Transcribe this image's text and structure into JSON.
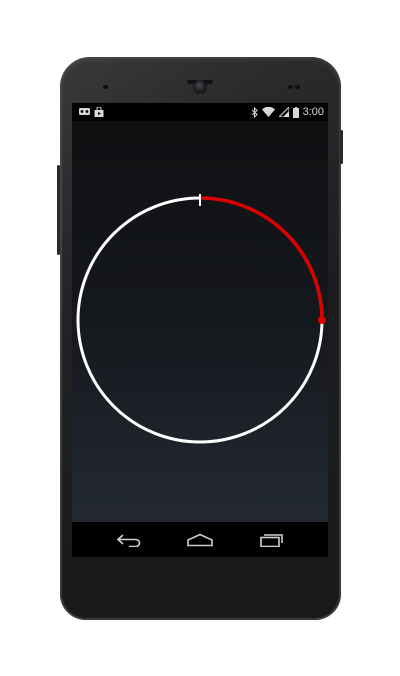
{
  "status_bar": {
    "time": "3:00",
    "left_icons": [
      "voicemail-icon",
      "shopping-bag-icon"
    ],
    "right_icons": [
      "bluetooth-icon",
      "wifi-icon",
      "cell-signal-icon",
      "battery-icon"
    ]
  },
  "timer": {
    "progress_fraction": 0.25,
    "track_color": "#ffffff",
    "progress_color": "#dd0000"
  },
  "nav_bar": {
    "buttons": [
      "back-icon",
      "home-icon",
      "recent-apps-icon"
    ]
  }
}
